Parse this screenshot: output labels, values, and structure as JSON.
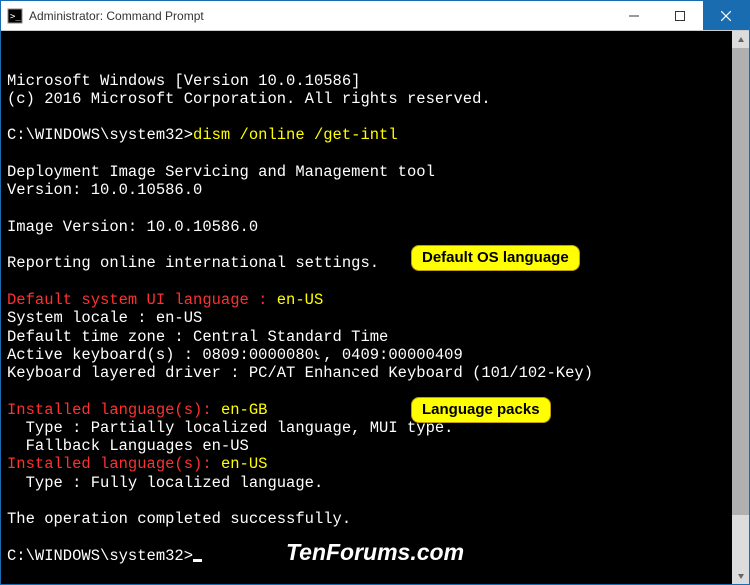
{
  "window": {
    "title": "Administrator: Command Prompt"
  },
  "terminal": {
    "line1": "Microsoft Windows [Version 10.0.10586]",
    "line2": "(c) 2016 Microsoft Corporation. All rights reserved.",
    "prompt1": "C:\\WINDOWS\\system32>",
    "command": "dism /online /get-intl",
    "line_tool": "Deployment Image Servicing and Management tool",
    "line_ver": "Version: 10.0.10586.0",
    "line_imgver": "Image Version: 10.0.10586.0",
    "line_report": "Reporting online international settings.",
    "r_default_label": "Default system UI language : ",
    "r_default_val": "en-US",
    "line_locale": "System locale : en-US",
    "line_tz": "Default time zone : Central Standard Time",
    "line_kb": "Active keyboard(s) : 0809:00000809, 0409:00000409",
    "line_drv": "Keyboard layered driver : PC/AT Enhanced Keyboard (101/102-Key)",
    "r_inst1_label": "Installed language(s): ",
    "r_inst1_val": "en-GB",
    "line_type1": "  Type : Partially localized language, MUI type.",
    "line_fallback": "  Fallback Languages en-US",
    "r_inst2_label": "Installed language(s): ",
    "r_inst2_val": "en-US",
    "line_type2": "  Type : Fully localized language.",
    "line_success": "The operation completed successfully.",
    "prompt2": "C:\\WINDOWS\\system32>"
  },
  "callouts": {
    "c1": "Default OS language",
    "c2": "Language packs"
  },
  "watermark": "TenForums.com"
}
